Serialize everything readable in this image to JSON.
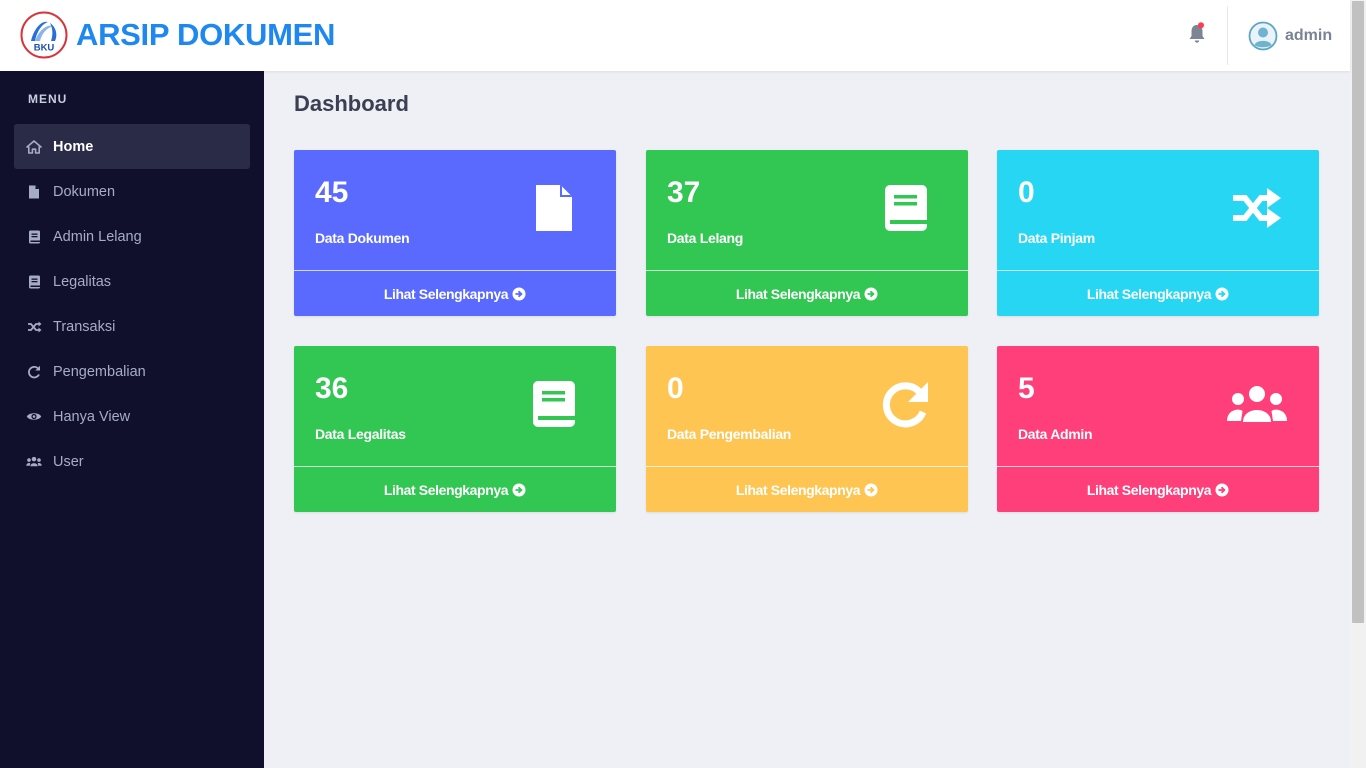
{
  "header": {
    "logo_text": "BKU",
    "app_title": "ARSIP DOKUMEN",
    "user_name": "admin"
  },
  "sidebar": {
    "menu_title": "MENU",
    "items": [
      {
        "label": "Home",
        "icon": "home-icon",
        "active": true
      },
      {
        "label": "Dokumen",
        "icon": "file-icon",
        "active": false
      },
      {
        "label": "Admin Lelang",
        "icon": "book-icon",
        "active": false
      },
      {
        "label": "Legalitas",
        "icon": "book-icon",
        "active": false
      },
      {
        "label": "Transaksi",
        "icon": "shuffle-icon",
        "active": false
      },
      {
        "label": "Pengembalian",
        "icon": "redo-icon",
        "active": false
      },
      {
        "label": "Hanya View",
        "icon": "eye-icon",
        "active": false
      },
      {
        "label": "User",
        "icon": "users-icon",
        "active": false
      }
    ]
  },
  "main": {
    "page_title": "Dashboard",
    "cards": [
      {
        "count": "45",
        "label": "Data Dokumen",
        "link": "Lihat Selengkapnya",
        "icon": "file-icon",
        "color": "#5a6aff"
      },
      {
        "count": "37",
        "label": "Data Lelang",
        "link": "Lihat Selengkapnya",
        "icon": "book-icon",
        "color": "#32c653"
      },
      {
        "count": "0",
        "label": "Data Pinjam",
        "link": "Lihat Selengkapnya",
        "icon": "shuffle-icon",
        "color": "#27d6f2"
      },
      {
        "count": "36",
        "label": "Data Legalitas",
        "link": "Lihat Selengkapnya",
        "icon": "book-icon",
        "color": "#32c653"
      },
      {
        "count": "0",
        "label": "Data Pengembalian",
        "link": "Lihat Selengkapnya",
        "icon": "redo-icon",
        "color": "#fec553"
      },
      {
        "count": "5",
        "label": "Data Admin",
        "link": "Lihat Selengkapnya",
        "icon": "users-icon",
        "color": "#fe3f79"
      }
    ]
  }
}
